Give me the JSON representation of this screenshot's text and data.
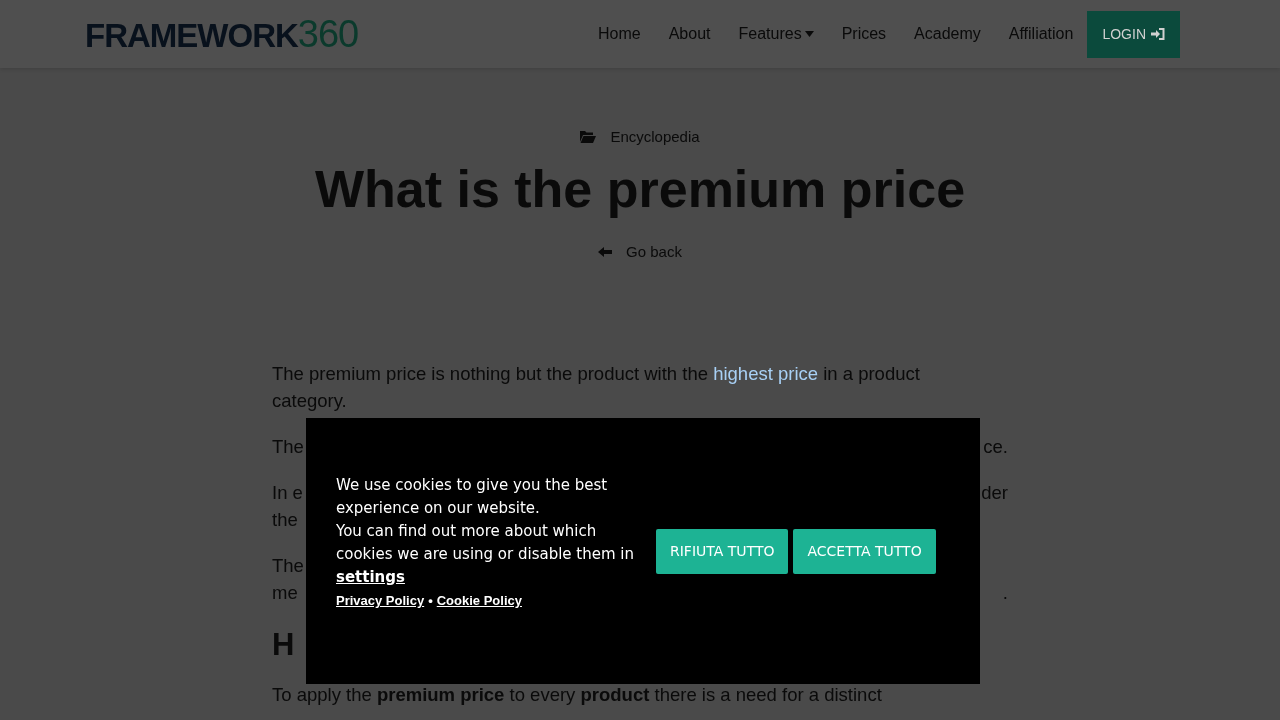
{
  "header": {
    "logo": {
      "word": "FRAMEWORK",
      "number": "360"
    },
    "nav": [
      {
        "label": "Home",
        "dropdown": false
      },
      {
        "label": "About",
        "dropdown": false
      },
      {
        "label": "Features",
        "dropdown": true
      },
      {
        "label": "Prices",
        "dropdown": false
      },
      {
        "label": "Academy",
        "dropdown": false
      },
      {
        "label": "Affiliation",
        "dropdown": false
      }
    ],
    "login": "LOGIN"
  },
  "hero": {
    "category": "Encyclopedia",
    "title": "What is the premium price",
    "back": "Go back"
  },
  "article": {
    "intro": {
      "before": "The premium price is nothing but the product with the ",
      "link": "highest price",
      "after": " in a product category."
    },
    "fragments": [
      {
        "lines": [
          {
            "left": "The",
            "right": "ce."
          }
        ]
      },
      {
        "lines": [
          {
            "left": "In e",
            "right": "der"
          },
          {
            "left": "the"
          }
        ]
      },
      {
        "lines": [
          {
            "left": "The"
          },
          {
            "left": "me",
            "right": "."
          }
        ]
      }
    ],
    "heading": "H",
    "last": "To apply the **premium price** to every **product** there is a need for a distinct"
  },
  "cookie_banner": {
    "message": "We use cookies to give you the best experience on our website.",
    "more": "You can find out more about which cookies we are using or disable them in",
    "settings_link": "settings",
    "links": [
      "Privacy Policy",
      "Cookie Policy"
    ],
    "separator": "•",
    "buttons": [
      "RIFIUTA TUTTO",
      "ACCETTA TUTTO"
    ]
  }
}
